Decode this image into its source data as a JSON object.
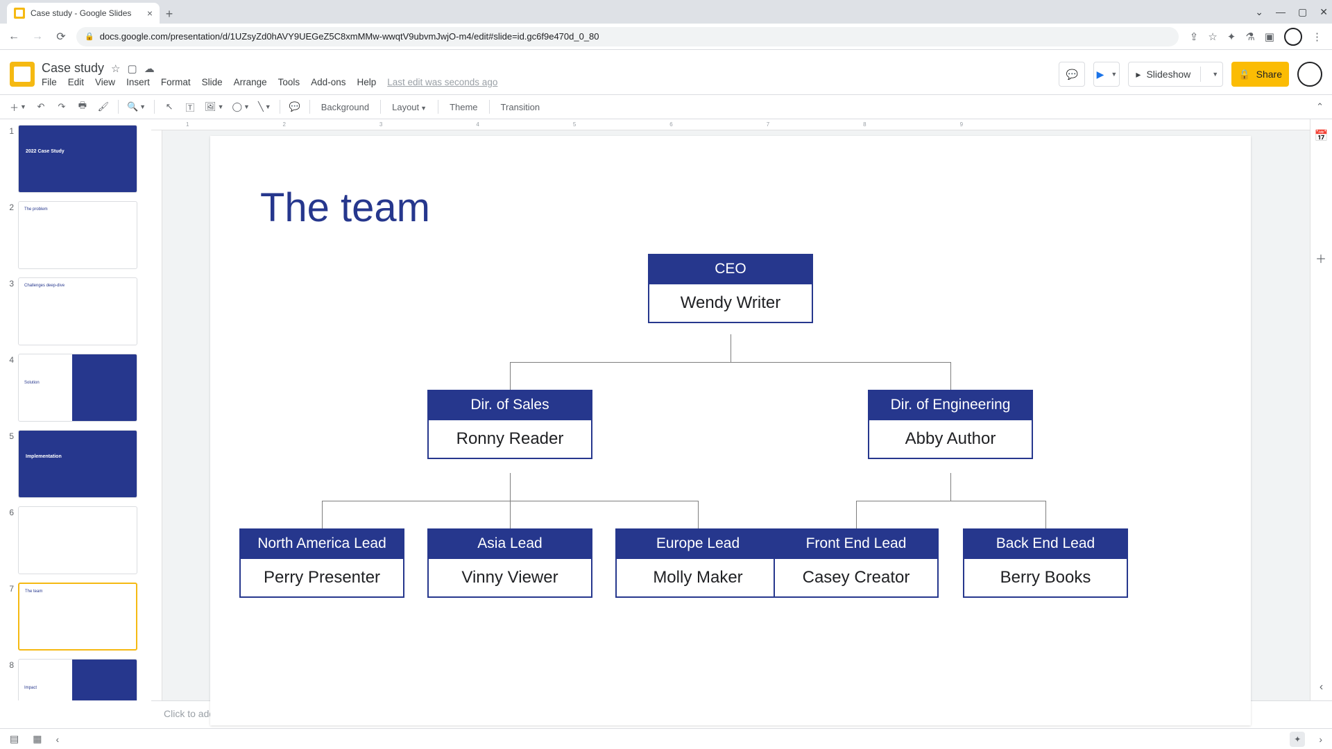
{
  "browser": {
    "tab_title": "Case study - Google Slides",
    "url": "docs.google.com/presentation/d/1UZsyZd0hAVY9UEGeZ5C8xmMMw-wwqtV9ubvmJwjO-m4/edit#slide=id.gc6f9e470d_0_80"
  },
  "doc": {
    "title": "Case study",
    "menus": [
      "File",
      "Edit",
      "View",
      "Insert",
      "Format",
      "Slide",
      "Arrange",
      "Tools",
      "Add-ons",
      "Help"
    ],
    "last_edit": "Last edit was seconds ago",
    "slideshow_label": "Slideshow",
    "share_label": "Share"
  },
  "toolbar": {
    "background": "Background",
    "layout": "Layout",
    "theme": "Theme",
    "transition": "Transition"
  },
  "thumbs": [
    {
      "n": "1",
      "kind": "blue",
      "label": "2022 Case Study"
    },
    {
      "n": "2",
      "kind": "white",
      "label": "The problem"
    },
    {
      "n": "3",
      "kind": "white",
      "label": "Challenges deep-dive"
    },
    {
      "n": "4",
      "kind": "half",
      "label": "Solution"
    },
    {
      "n": "5",
      "kind": "blue",
      "label": "Implementation"
    },
    {
      "n": "6",
      "kind": "white",
      "label": ""
    },
    {
      "n": "7",
      "kind": "white",
      "label": "The team",
      "selected": true
    },
    {
      "n": "8",
      "kind": "half",
      "label": "Impact"
    }
  ],
  "slide": {
    "title": "The team",
    "org": {
      "ceo": {
        "title": "CEO",
        "name": "Wendy Writer"
      },
      "sales": {
        "title": "Dir. of Sales",
        "name": "Ronny Reader"
      },
      "eng": {
        "title": "Dir. of Engineering",
        "name": "Abby Author"
      },
      "na": {
        "title": "North America Lead",
        "name": "Perry Presenter"
      },
      "asia": {
        "title": "Asia Lead",
        "name": "Vinny Viewer"
      },
      "eu": {
        "title": "Europe Lead",
        "name": "Molly Maker"
      },
      "fe": {
        "title": "Front End Lead",
        "name": "Casey Creator"
      },
      "be": {
        "title": "Back End Lead",
        "name": "Berry Books"
      }
    }
  },
  "notes_placeholder": "Click to add speaker notes",
  "ruler_marks": [
    "1",
    "2",
    "3",
    "4",
    "5",
    "6",
    "7",
    "8",
    "9"
  ]
}
